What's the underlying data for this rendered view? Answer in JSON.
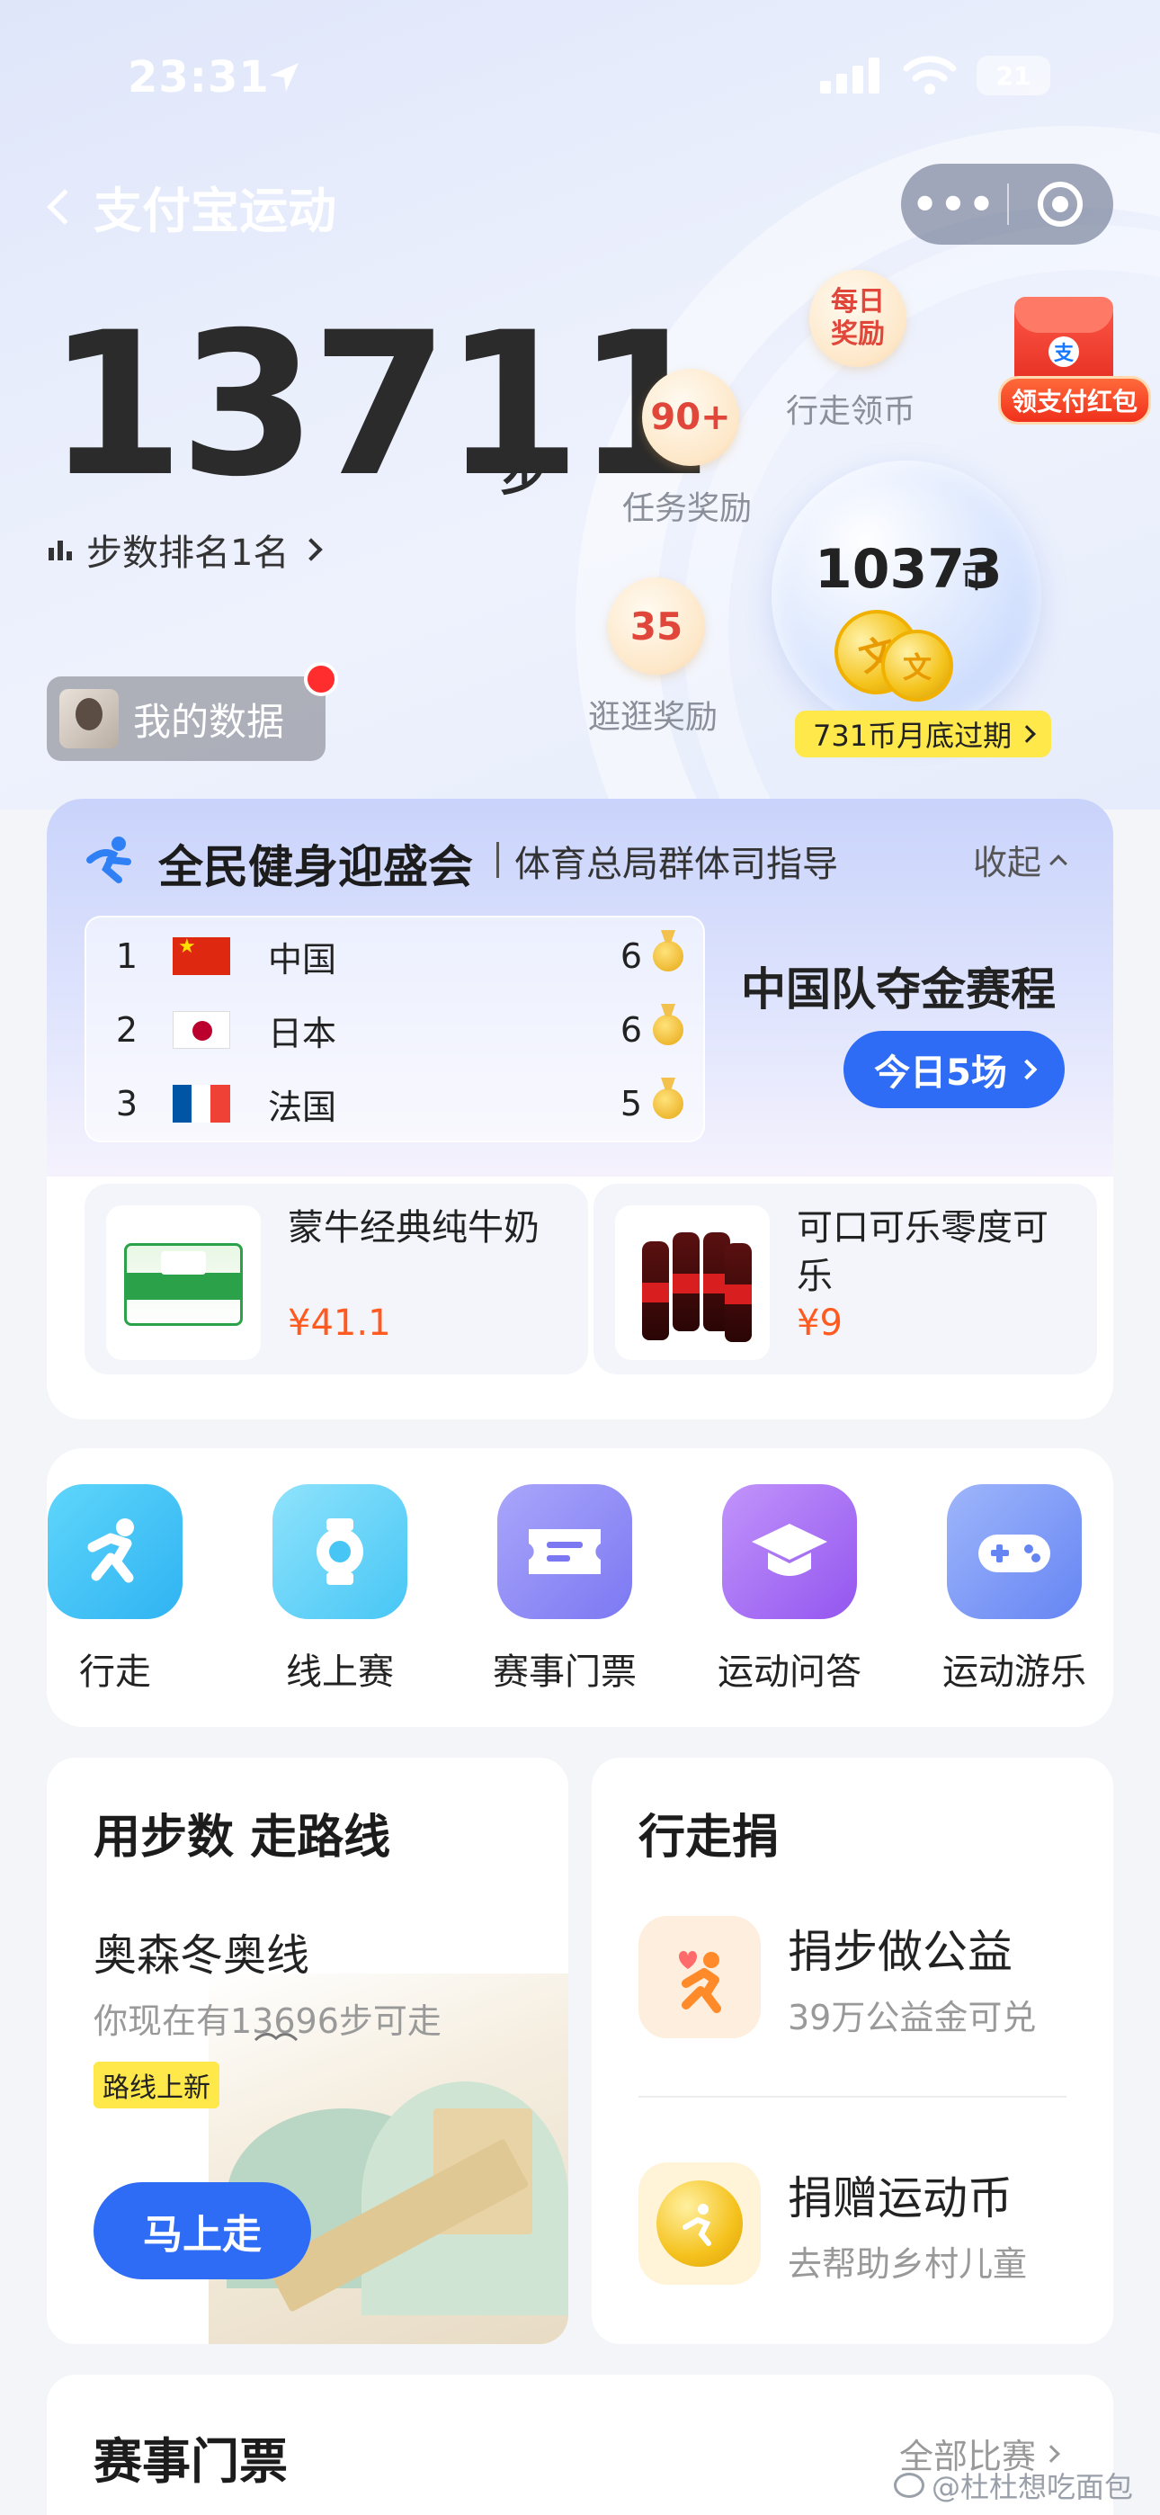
{
  "status_bar": {
    "time": "23:31",
    "battery": "21"
  },
  "nav": {
    "title": "支付宝运动",
    "more_label": "•••"
  },
  "steps": {
    "count": "13711",
    "unit": "步",
    "rank": "步数排名1名"
  },
  "my_data": {
    "label": "我的数据"
  },
  "bubbles": {
    "daily": {
      "value": "每日\n奖励",
      "label": "行走领币"
    },
    "task": {
      "value": "90+",
      "label": "任务奖励"
    },
    "browse": {
      "value": "35",
      "label": "逛逛奖励"
    }
  },
  "coins": {
    "count": "10373",
    "unit": "币",
    "expire": "731币月底过期"
  },
  "hongbao": {
    "label": "领支付红包"
  },
  "event": {
    "title": "全民健身迎盛会",
    "subtitle": "体育总局群体司指导",
    "collapse": "收起",
    "medal_table": [
      {
        "rank": "1",
        "country": "中国",
        "flag": "cn",
        "gold": "6"
      },
      {
        "rank": "2",
        "country": "日本",
        "flag": "jp",
        "gold": "6"
      },
      {
        "rank": "3",
        "country": "法国",
        "flag": "fr",
        "gold": "5"
      }
    ],
    "schedule_title": "中国队夺金赛程",
    "schedule_button": "今日5场",
    "products": [
      {
        "name": "蒙牛经典纯牛奶",
        "price": "¥41.1"
      },
      {
        "name": "可口可乐零度可乐",
        "price": "¥9"
      }
    ]
  },
  "shortcuts": [
    {
      "label": "行走",
      "icon": "walk-icon",
      "color": "#3ec5f5"
    },
    {
      "label": "线上赛",
      "icon": "watch-icon",
      "color": "#5fd0f8"
    },
    {
      "label": "赛事门票",
      "icon": "ticket-icon",
      "color": "#8a86f5"
    },
    {
      "label": "运动问答",
      "icon": "graduation-cap-icon",
      "color": "#a36cf2"
    },
    {
      "label": "运动游乐",
      "icon": "gamepad-icon",
      "color": "#6f8ff7"
    }
  ],
  "route": {
    "title": "用步数 走路线",
    "name": "奥森冬奥线",
    "desc": "你现在有13696步可走",
    "tag": "路线上新",
    "button": "马上走"
  },
  "donate": {
    "title": "行走捐",
    "items": [
      {
        "name": "捐步做公益",
        "desc": "39万公益金可兑"
      },
      {
        "name": "捐赠运动币",
        "desc": "去帮助乡村儿童"
      }
    ]
  },
  "tickets": {
    "title": "赛事门票",
    "all": "全部比赛"
  },
  "watermark": "@杜杜想吃面包"
}
